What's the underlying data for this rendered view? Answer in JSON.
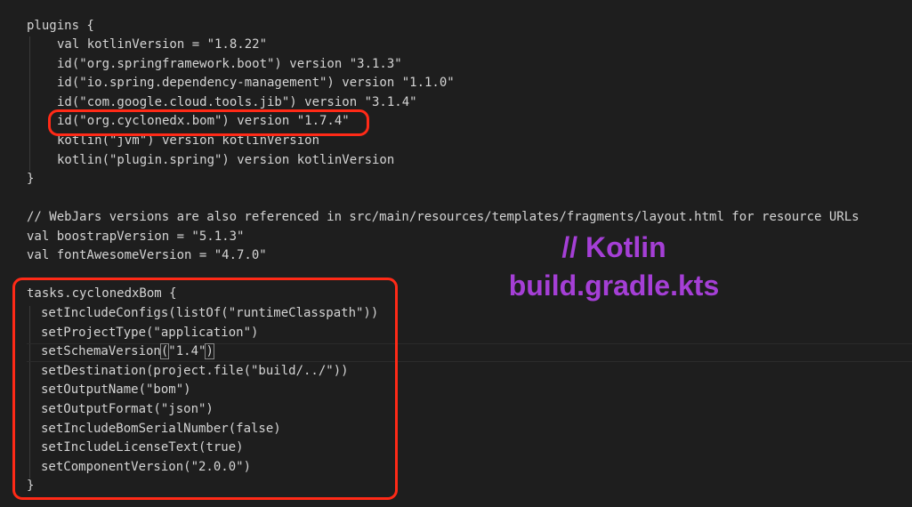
{
  "editor": {
    "lines": {
      "l01": "plugins {",
      "l02": "val kotlinVersion = \"1.8.22\"",
      "l03": "id(\"org.springframework.boot\") version \"3.1.3\"",
      "l04": "id(\"io.spring.dependency-management\") version \"1.1.0\"",
      "l05": "id(\"com.google.cloud.tools.jib\") version \"3.1.4\"",
      "l06": "id(\"org.cyclonedx.bom\") version \"1.7.4\"",
      "l07": "kotlin(\"jvm\") version kotlinVersion",
      "l08": "kotlin(\"plugin.spring\") version kotlinVersion",
      "l09": "}",
      "l10": "// WebJars versions are also referenced in src/main/resources/templates/fragments/layout.html for resource URLs",
      "l11": "val boostrapVersion = \"5.1.3\"",
      "l12": "val fontAwesomeVersion = \"4.7.0\"",
      "l13": "tasks.cyclonedxBom {",
      "l14": "setIncludeConfigs(listOf(\"runtimeClasspath\"))",
      "l15": "setProjectType(\"application\")",
      "l16a": "setSchemaVersion",
      "l16b": "(",
      "l16c": "\"1.4\"",
      "l16d": ")",
      "l17": "setDestination(project.file(\"build/../\"))",
      "l18": "setOutputName(\"bom\")",
      "l19": "setOutputFormat(\"json\")",
      "l20": "setIncludeBomSerialNumber(false)",
      "l21": "setIncludeLicenseText(true)",
      "l22": "setComponentVersion(\"2.0.0\")",
      "l23": "}"
    }
  },
  "annotation": {
    "line1": "// Kotlin",
    "line2": "build.gradle.kts",
    "color": "#a53fd6"
  },
  "highlight_color": "#ff2a17"
}
